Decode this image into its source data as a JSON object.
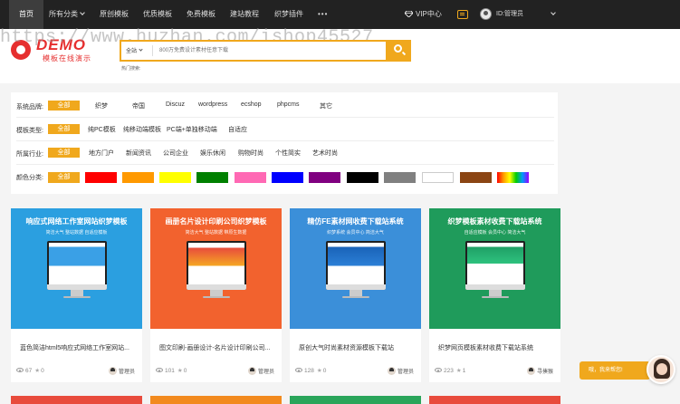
{
  "nav": {
    "items": [
      {
        "label": "首页",
        "active": true
      },
      {
        "label": "所有分类",
        "dropdown": true
      },
      {
        "label": "原创模板"
      },
      {
        "label": "优质模板"
      },
      {
        "label": "免费模板"
      },
      {
        "label": "建站教程"
      },
      {
        "label": "织梦插件"
      },
      {
        "label": "•••"
      }
    ],
    "vip_label": "VIP中心",
    "user_label": "ID:管理员"
  },
  "header": {
    "logo_text": "DEMO",
    "logo_sub": "模板在线演示",
    "watermark": "https://www.huzhan.com/ishop45527",
    "search": {
      "category": "全站",
      "placeholder": "800万免费设计素材任意下载"
    },
    "hot_search_label": "热门搜索:"
  },
  "filters": {
    "rows": [
      {
        "label": "系统品牌:",
        "options": [
          "全部",
          "织梦",
          "帝国",
          "Discuz",
          "wordpress",
          "ecshop",
          "phpcms",
          "其它"
        ]
      },
      {
        "label": "模板类型:",
        "options": [
          "全部",
          "纯PC模板",
          "纯移动端模板",
          "PC端+单独移动端",
          "自适应"
        ]
      },
      {
        "label": "所属行业:",
        "options": [
          "全部",
          "地方门户",
          "新闻资讯",
          "公司企业",
          "娱乐休闲",
          "购物时尚",
          "个性简实",
          "艺术时尚"
        ]
      }
    ],
    "color_label": "颜色分类:",
    "color_all": "全部",
    "colors": [
      "#ff0000",
      "#ff9900",
      "#ffff00",
      "#008000",
      "#ff69b4",
      "#0000ff",
      "#800080",
      "#000000",
      "#808080",
      "#ffffff",
      "#8b4513",
      "rainbow"
    ]
  },
  "cards": [
    {
      "thumb_title": "响应式网络工作室网站织梦模板",
      "thumb_sub": "简洁大气 整站数据 自适应模板",
      "bg": "#2b9fe0",
      "title": "蓝色简洁html5响应式网络工作室网站...",
      "views": "67",
      "stars": "0",
      "user": "管理员"
    },
    {
      "thumb_title": "画册名片设计印刷公司织梦模板",
      "thumb_sub": "简洁大气 整站数据 带原生数据",
      "bg": "#f2622e",
      "title": "图文印刷-画册设计-名片设计印刷公司...",
      "views": "101",
      "stars": "0",
      "user": "管理员"
    },
    {
      "thumb_title": "精仿FE素材网收费下载站系统",
      "thumb_sub": "织梦系统 会员中心 简洁大气",
      "bg": "#3b8fd9",
      "title": "原创大气时尚素材资源模板下载站",
      "views": "128",
      "stars": "0",
      "user": "管理员"
    },
    {
      "thumb_title": "织梦模板素材收费下载站系统",
      "thumb_sub": "自适应模板 会员中心 简洁大气",
      "bg": "#1f9b5b",
      "title": "织梦网页模板素材收费下载站系统",
      "views": "223",
      "stars": "1",
      "user": "寻揍猴"
    }
  ],
  "chat": {
    "label": "哦，我来帮您!"
  }
}
